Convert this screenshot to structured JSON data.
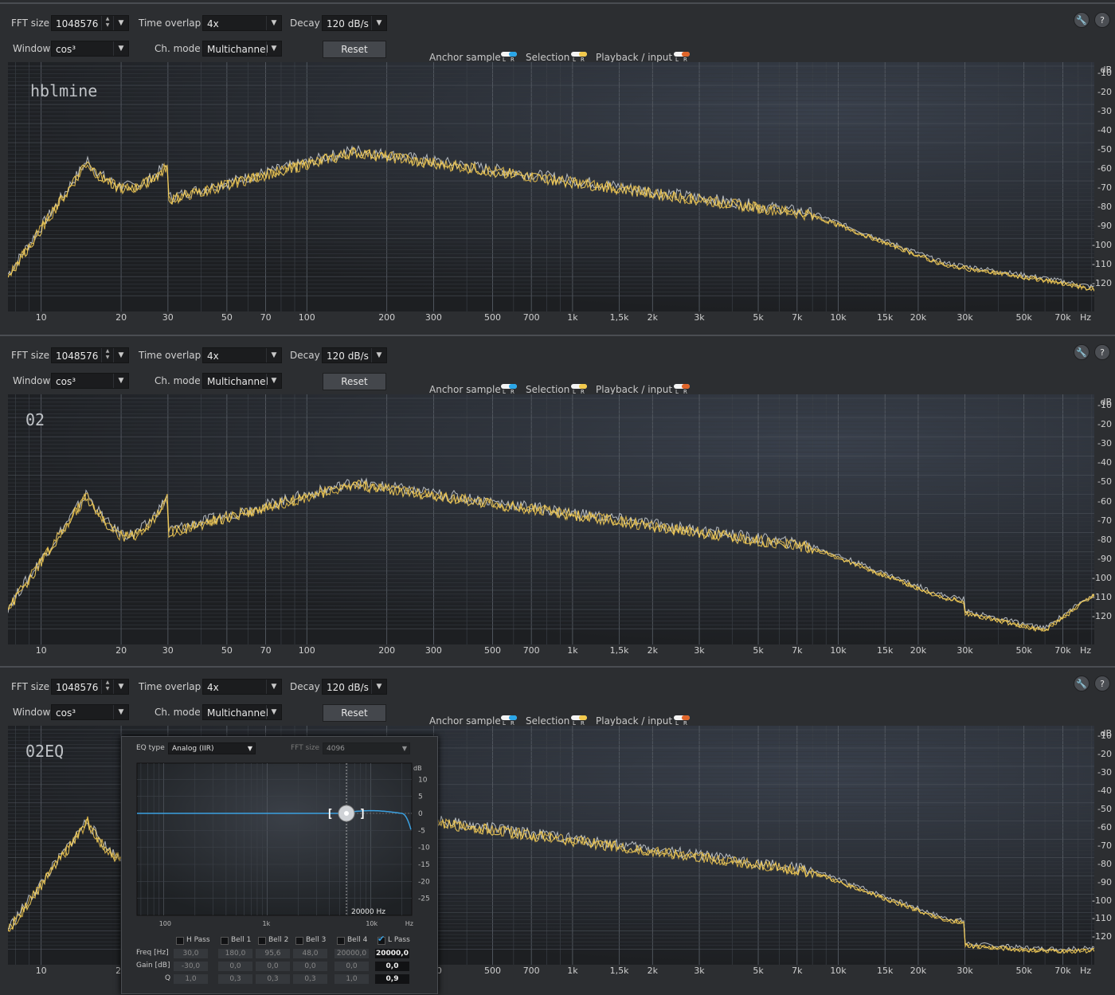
{
  "controls": {
    "fft_size_label": "FFT size",
    "fft_size_value": "1048576",
    "time_overlap_label": "Time overlap",
    "time_overlap_value": "4x",
    "decay_label": "Decay",
    "decay_value": "120 dB/s",
    "window_label": "Window",
    "window_value": "cos³",
    "ch_mode_label": "Ch. mode",
    "ch_mode_value": "Multichannel",
    "reset_label": "Reset",
    "settings_icon": "wrench-icon",
    "help_label": "?"
  },
  "legend": {
    "anchor": "Anchor sample",
    "selection": "Selection",
    "playback": "Playback / input",
    "l": "L",
    "r": "R",
    "colors": {
      "anchor": "#2aa6e8",
      "selection": "#f2c94c",
      "playback": "#e0652a"
    }
  },
  "panels": [
    {
      "title": "hblmine"
    },
    {
      "title": "02"
    },
    {
      "title": "02EQ"
    }
  ],
  "db_axis": {
    "unit": "dB",
    "ticks": [
      "-10",
      "-20",
      "-30",
      "-40",
      "-50",
      "-60",
      "-70",
      "-80",
      "-90",
      "-100",
      "-110",
      "-120"
    ]
  },
  "hz_axis": {
    "unit": "Hz",
    "ticks": [
      "10",
      "20",
      "30",
      "50",
      "70",
      "100",
      "200",
      "300",
      "500",
      "700",
      "1k",
      "1,5k",
      "2k",
      "3k",
      "5k",
      "7k",
      "10k",
      "15k",
      "20k",
      "30k",
      "50k",
      "70k"
    ]
  },
  "eq_popup": {
    "eq_type_label": "EQ type",
    "eq_type_value": "Analog (IIR)",
    "fft_size_label": "FFT size",
    "fft_size_value": "4096",
    "db_unit": "dB",
    "db_ticks": [
      "10",
      "5",
      "0",
      "-5",
      "-10",
      "-15",
      "-20",
      "-25"
    ],
    "hz_ticks": [
      "100",
      "1k",
      "10k",
      "Hz"
    ],
    "marker_freq": "20000 Hz",
    "row_labels": {
      "freq": "Freq [Hz]",
      "gain": "Gain [dB]",
      "q": "Q"
    },
    "bands": [
      {
        "name": "H Pass",
        "checked": false,
        "freq": "30,0",
        "gain": "-30,0",
        "q": "1,0"
      },
      {
        "name": "Bell 1",
        "checked": false,
        "freq": "180,0",
        "gain": "0,0",
        "q": "0,3"
      },
      {
        "name": "Bell 2",
        "checked": false,
        "freq": "95,6",
        "gain": "0,0",
        "q": "0,3"
      },
      {
        "name": "Bell 3",
        "checked": false,
        "freq": "48,0",
        "gain": "0,0",
        "q": "0,3"
      },
      {
        "name": "Bell 4",
        "checked": false,
        "freq": "20000,0",
        "gain": "0,0",
        "q": "1,0"
      },
      {
        "name": "L Pass",
        "checked": true,
        "freq": "20000,0",
        "gain": "0,0",
        "q": "0,9"
      }
    ],
    "check_icon": "checkmark-icon",
    "handle_brackets": [
      "[",
      "]"
    ]
  }
}
